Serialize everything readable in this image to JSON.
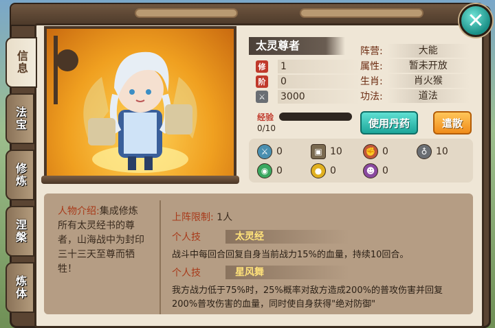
{
  "window": {
    "close_label": "✕"
  },
  "tabs": [
    {
      "label": "信息",
      "active": true
    },
    {
      "label": "法宝",
      "active": false
    },
    {
      "label": "修炼",
      "active": false
    },
    {
      "label": "涅槃",
      "active": false
    },
    {
      "label": "炼体",
      "active": false
    }
  ],
  "hero": {
    "name": "太灵尊者",
    "stats": [
      {
        "icon": "level-icon",
        "glyph": "修",
        "value": "1"
      },
      {
        "icon": "rank-icon",
        "glyph": "阶",
        "value": "0"
      },
      {
        "icon": "sword-icon",
        "glyph": "⚔",
        "value": "3000"
      }
    ],
    "attributes": [
      {
        "label": "阵营:",
        "value": "大能"
      },
      {
        "label": "属性:",
        "value": "暂未开放"
      },
      {
        "label": "生肖:",
        "value": "肖火猴"
      },
      {
        "label": "功法:",
        "value": "道法"
      }
    ],
    "exp_label": "经验",
    "exp_text": "0/10",
    "exp_progress": 0
  },
  "buttons": {
    "use_pill": "使用丹药",
    "dismiss": "遣散"
  },
  "equipment": [
    {
      "icon": "weapon-icon",
      "value": "0",
      "color": "#4a8fb0"
    },
    {
      "icon": "armor-icon",
      "value": "10",
      "color": "#7a6a50"
    },
    {
      "icon": "fist-icon",
      "value": "0",
      "color": "#c0563a"
    },
    {
      "icon": "bell-icon",
      "value": "10",
      "color": "#6a6e73"
    },
    {
      "icon": "orb-icon",
      "value": "0",
      "color": "#3aa860"
    },
    {
      "icon": "gold-icon",
      "value": "0",
      "color": "#e0b020"
    },
    {
      "icon": "figure-icon",
      "value": "0",
      "color": "#8a4aa0"
    }
  ],
  "intro": {
    "label": "人物介绍:",
    "text": "集成修炼所有太灵经书的尊者，山海战中为封印三十三天至尊而牺牲！"
  },
  "limit": {
    "label": "上阵限制:",
    "value": "1人"
  },
  "skills": [
    {
      "tag": "个人技",
      "name": "太灵经",
      "desc": "战斗中每回合回复自身当前战力15%的血量，持续10回合。"
    },
    {
      "tag": "个人技",
      "name": "星风舞",
      "desc": "我方战力低于75%时，25%概率对敌方造成200%的普攻伤害并回复200%普攻伤害的血量，同时使自身获得\"绝对防御\""
    }
  ]
}
